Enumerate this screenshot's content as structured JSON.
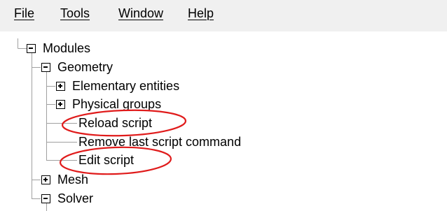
{
  "menu": {
    "items": [
      {
        "label": "File"
      },
      {
        "label": "Tools"
      },
      {
        "label": "Window"
      },
      {
        "label": "Help"
      }
    ]
  },
  "tree": {
    "modules": {
      "label": "Modules",
      "state": "expanded"
    },
    "geometry": {
      "label": "Geometry",
      "state": "expanded"
    },
    "elementary_entities": {
      "label": "Elementary entities",
      "state": "collapsed"
    },
    "physical_groups": {
      "label": "Physical groups",
      "state": "collapsed"
    },
    "reload_script": {
      "label": "Reload script"
    },
    "remove_last_script_command": {
      "label": "Remove last script command"
    },
    "edit_script": {
      "label": "Edit script"
    },
    "mesh": {
      "label": "Mesh",
      "state": "collapsed"
    },
    "solver": {
      "label": "Solver",
      "state": "expanded"
    }
  },
  "colors": {
    "menubar_bg": "#f0f0f0",
    "tree_line": "#a0a0a0",
    "highlight_ellipse": "#e01b1b"
  },
  "icons": [
    "expand-plus-icon",
    "collapse-minus-icon"
  ]
}
